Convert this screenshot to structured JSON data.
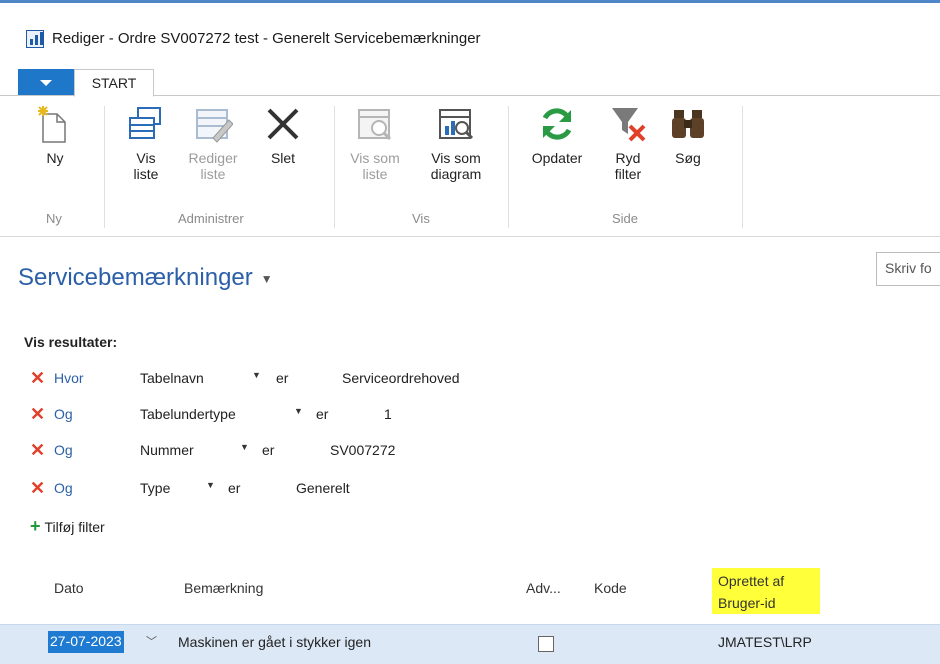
{
  "window": {
    "title": "Rediger - Ordre SV007272 test - Generelt Servicebemærkninger"
  },
  "ribbon": {
    "tabs": [
      "START"
    ],
    "groups": [
      {
        "label": "Ny",
        "buttons": [
          {
            "label": "Ny",
            "icon": "new-document-icon",
            "enabled": true
          }
        ]
      },
      {
        "label": "Administrer",
        "buttons": [
          {
            "label": "Vis\nliste",
            "icon": "view-list-icon",
            "enabled": true
          },
          {
            "label": "Rediger\nliste",
            "icon": "edit-list-icon",
            "enabled": false
          },
          {
            "label": "Slet",
            "icon": "delete-x-icon",
            "enabled": true
          }
        ]
      },
      {
        "label": "Vis",
        "buttons": [
          {
            "label": "Vis som\nliste",
            "icon": "view-as-list-icon",
            "enabled": false
          },
          {
            "label": "Vis som\ndiagram",
            "icon": "view-as-chart-icon",
            "enabled": true
          }
        ]
      },
      {
        "label": "Side",
        "buttons": [
          {
            "label": "Opdater",
            "icon": "refresh-icon",
            "enabled": true
          },
          {
            "label": "Ryd\nfilter",
            "icon": "clear-filter-icon",
            "enabled": true
          },
          {
            "label": "Søg",
            "icon": "binoculars-icon",
            "enabled": true
          }
        ]
      }
    ]
  },
  "page": {
    "title": "Servicebemærkninger",
    "search_placeholder": "Skriv fo"
  },
  "filters": {
    "heading": "Vis resultater:",
    "rows": [
      {
        "op": "Hvor",
        "field": "Tabelnavn",
        "rel": "er",
        "value": "Serviceordrehoved"
      },
      {
        "op": "Og",
        "field": "Tabelundertype",
        "rel": "er",
        "value": "1"
      },
      {
        "op": "Og",
        "field": "Nummer",
        "rel": "er",
        "value": "SV007272"
      },
      {
        "op": "Og",
        "field": "Type",
        "rel": "er",
        "value": "Generelt"
      }
    ],
    "add_label": "Tilføj filter"
  },
  "grid": {
    "columns": {
      "dato": "Dato",
      "bemaerkning": "Bemærkning",
      "adv": "Adv...",
      "kode": "Kode",
      "oprettet_line1": "Oprettet af",
      "oprettet_line2": "Bruger-id"
    },
    "rows": [
      {
        "dato": "27-07-2023",
        "bemaerkning": "Maskinen er gået i stykker igen",
        "adv": false,
        "kode": "",
        "bruger": "JMATEST\\LRP"
      }
    ]
  },
  "colors": {
    "accent": "#1e77c9",
    "link": "#2b5fa8",
    "highlight": "#ffff3a",
    "delete": "#e0402a",
    "add": "#1e9a3a"
  }
}
